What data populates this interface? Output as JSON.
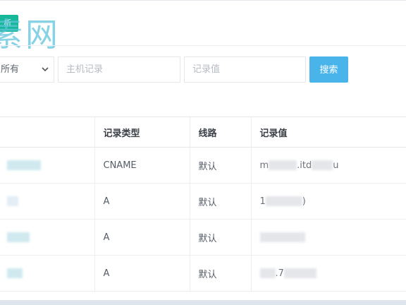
{
  "watermark": "素网",
  "corner_tag": "析",
  "filters": {
    "type_select_value": "所有",
    "host_placeholder": "主机记录",
    "value_placeholder": "记录值",
    "search_button": "搜索"
  },
  "table": {
    "headers": [
      "",
      "记录类型",
      "线路",
      "记录值"
    ],
    "rows": [
      {
        "type": "CNAME",
        "line": "默认",
        "value_start": "m",
        "value_mid": ".itd",
        "value_end": "u"
      },
      {
        "type": "A",
        "line": "默认",
        "value_start": "1",
        "value_mid": "",
        "value_end": ")"
      },
      {
        "type": "A",
        "line": "默认",
        "value_start": "",
        "value_mid": "",
        "value_end": ""
      },
      {
        "type": "A",
        "line": "默认",
        "value_start": "",
        "value_mid": ".7",
        "value_end": ""
      }
    ]
  },
  "colors": {
    "accent": "#49b4ea",
    "tag": "#17b89a",
    "watermark": "#5fc3db"
  }
}
